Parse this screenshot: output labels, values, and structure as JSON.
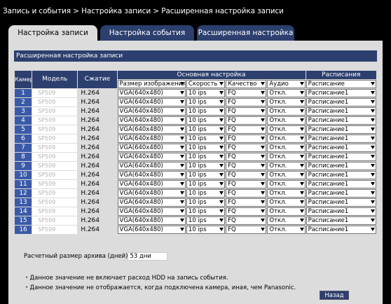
{
  "breadcrumb": "Запись и события > Настройка записи > Расширенная настройка записи",
  "tabs": [
    {
      "label": "Настройка записи",
      "active": true
    },
    {
      "label": "Настройка события",
      "active": false
    },
    {
      "label": "Расширенная настройка",
      "active": false
    }
  ],
  "section_title": "Расширенная настройка записи",
  "table": {
    "headers": {
      "camera": "Камера",
      "model": "Модель",
      "compression": "Сжатие",
      "main_group": "Основная настройка",
      "schedule_group": "Расписания"
    },
    "header_selects": {
      "image_size": "Размер изображения",
      "speed": "Скорость",
      "quality": "Качество",
      "audio": "Аудио",
      "schedule": "Расписание"
    },
    "rows": [
      {
        "camera": "1",
        "model": "SP509",
        "compression": "H.264",
        "image_size": "VGA(640x480)",
        "speed": "10 ips",
        "quality": "FQ",
        "audio": "Откл.",
        "schedule": "Расписание1"
      },
      {
        "camera": "2",
        "model": "SP509",
        "compression": "H.264",
        "image_size": "VGA(640x480)",
        "speed": "10 ips",
        "quality": "FQ",
        "audio": "Откл.",
        "schedule": "Расписание1"
      },
      {
        "camera": "3",
        "model": "SP509",
        "compression": "H.264",
        "image_size": "VGA(640x480)",
        "speed": "10 ips",
        "quality": "FQ",
        "audio": "Откл.",
        "schedule": "Расписание1"
      },
      {
        "camera": "4",
        "model": "SP509",
        "compression": "H.264",
        "image_size": "VGA(640x480)",
        "speed": "10 ips",
        "quality": "FQ",
        "audio": "Откл.",
        "schedule": "Расписание1"
      },
      {
        "camera": "5",
        "model": "SP509",
        "compression": "H.264",
        "image_size": "VGA(640x480)",
        "speed": "10 ips",
        "quality": "FQ",
        "audio": "Откл.",
        "schedule": "Расписание1"
      },
      {
        "camera": "6",
        "model": "SP509",
        "compression": "H.264",
        "image_size": "VGA(640x480)",
        "speed": "10 ips",
        "quality": "FQ",
        "audio": "Откл.",
        "schedule": "Расписание1"
      },
      {
        "camera": "7",
        "model": "SP509",
        "compression": "H.264",
        "image_size": "VGA(640x480)",
        "speed": "10 ips",
        "quality": "FQ",
        "audio": "Откл.",
        "schedule": "Расписание1"
      },
      {
        "camera": "8",
        "model": "SP509",
        "compression": "H.264",
        "image_size": "VGA(640x480)",
        "speed": "10 ips",
        "quality": "FQ",
        "audio": "Откл.",
        "schedule": "Расписание1"
      },
      {
        "camera": "9",
        "model": "SP509",
        "compression": "H.264",
        "image_size": "VGA(640x480)",
        "speed": "10 ips",
        "quality": "FQ",
        "audio": "Откл.",
        "schedule": "Расписание1"
      },
      {
        "camera": "10",
        "model": "SP509",
        "compression": "H.264",
        "image_size": "VGA(640x480)",
        "speed": "10 ips",
        "quality": "FQ",
        "audio": "Откл.",
        "schedule": "Расписание1"
      },
      {
        "camera": "11",
        "model": "SP509",
        "compression": "H.264",
        "image_size": "VGA(640x480)",
        "speed": "10 ips",
        "quality": "FQ",
        "audio": "Откл.",
        "schedule": "Расписание1"
      },
      {
        "camera": "12",
        "model": "SP509",
        "compression": "H.264",
        "image_size": "VGA(640x480)",
        "speed": "10 ips",
        "quality": "FQ",
        "audio": "Откл.",
        "schedule": "Расписание1"
      },
      {
        "camera": "13",
        "model": "SP509",
        "compression": "H.264",
        "image_size": "VGA(640x480)",
        "speed": "10 ips",
        "quality": "FQ",
        "audio": "Откл.",
        "schedule": "Расписание1"
      },
      {
        "camera": "14",
        "model": "SP509",
        "compression": "H.264",
        "image_size": "VGA(640x480)",
        "speed": "10 ips",
        "quality": "FQ",
        "audio": "Откл.",
        "schedule": "Расписание1"
      },
      {
        "camera": "15",
        "model": "SP509",
        "compression": "H.264",
        "image_size": "VGA(640x480)",
        "speed": "10 ips",
        "quality": "FQ",
        "audio": "Откл.",
        "schedule": "Расписание1"
      },
      {
        "camera": "16",
        "model": "SP509",
        "compression": "H.264",
        "image_size": "VGA(640x480)",
        "speed": "10 ips",
        "quality": "FQ",
        "audio": "Откл.",
        "schedule": "Расписание1"
      }
    ]
  },
  "archive": {
    "label": "Расчетный размер архива (дней)",
    "value": "53 дни"
  },
  "notes": [
    "・Данное значение не включает расход HDD на запись события.",
    "・Данное значение не отображается, когда подключена камера, иная, чем Panasonic."
  ],
  "back_button": "Назад",
  "colors": {
    "background": "#000000",
    "panel": "#dcdcdc",
    "header_blue": "#2c3f6e",
    "camera_blue": "#3a5aa8"
  }
}
